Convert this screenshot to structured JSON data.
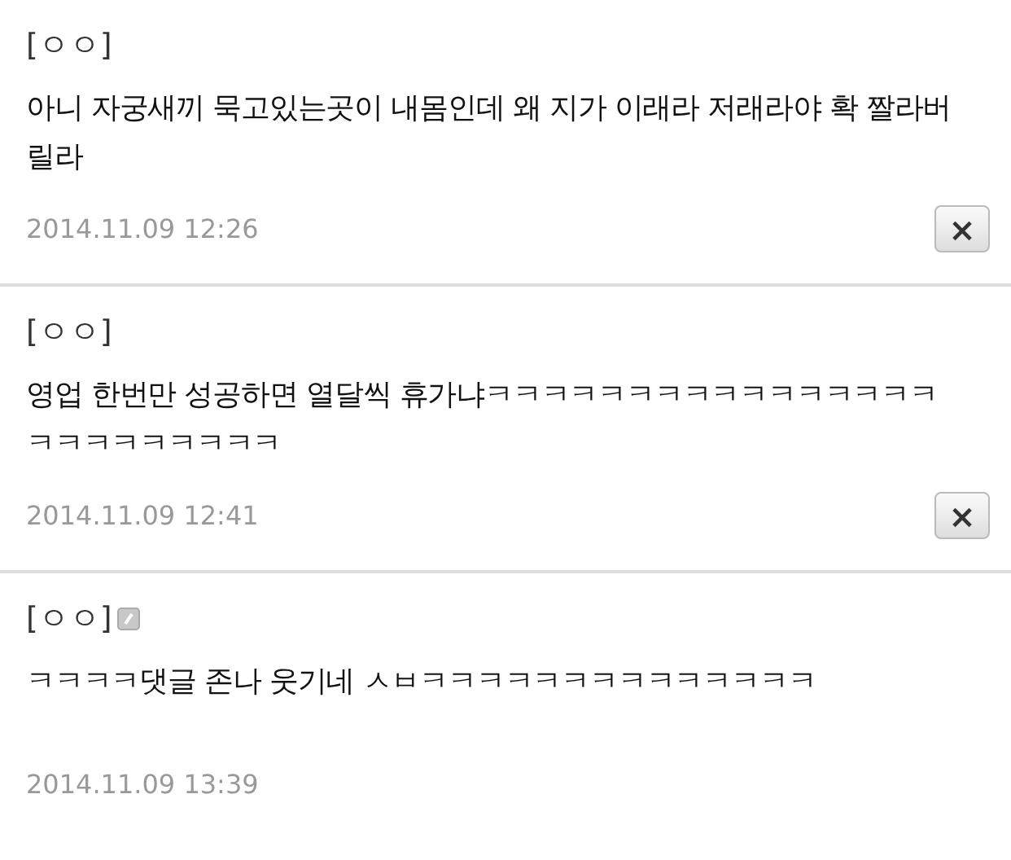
{
  "comments": [
    {
      "author": "[ㅇㅇ]",
      "mobile": false,
      "text": "아니 자궁새끼 묵고있는곳이 내몸인데 왜 지가 이래라 저래라야 확 짤라버릴라",
      "date": "2014.11.09 12:26",
      "delete_button": "×"
    },
    {
      "author": "[ㅇㅇ]",
      "mobile": false,
      "text": "영업 한번만 성공하면 열달씩 휴가냐ㅋㅋㅋㅋㅋㅋㅋㅋㅋㅋㅋㅋㅋㅋㅋㅋㅋㅋㅋㅋㅋㅋㅋㅋㅋ",
      "date": "2014.11.09 12:41",
      "delete_button": "×"
    },
    {
      "author": "[ㅇㅇ]",
      "mobile": true,
      "text": "ㅋㅋㅋㅋ댓글 존나 웃기네 ㅅㅂㅋㅋㅋㅋㅋㅋㅋㅋㅋㅋㅋㅋㅋㅋ",
      "date": "2014.11.09 13:39"
    }
  ]
}
